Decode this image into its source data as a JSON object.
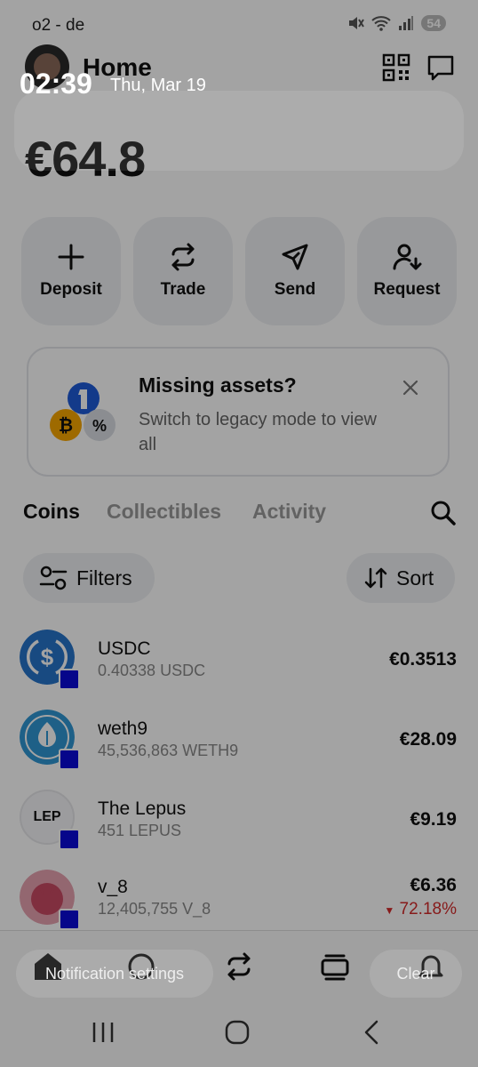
{
  "status_bar": {
    "carrier": "o2 - de",
    "battery": "54"
  },
  "lock_overlay": {
    "time": "02:39",
    "date": "Thu, Mar 19"
  },
  "header": {
    "title": "Home"
  },
  "balance": "€64.8",
  "actions": [
    {
      "label": "Deposit",
      "icon": "plus-icon"
    },
    {
      "label": "Trade",
      "icon": "trade-arrows-icon"
    },
    {
      "label": "Send",
      "icon": "send-icon"
    },
    {
      "label": "Request",
      "icon": "request-user-icon"
    }
  ],
  "banner": {
    "title": "Missing assets?",
    "text": "Switch to legacy mode to view all"
  },
  "tabs": [
    {
      "label": "Coins",
      "active": true
    },
    {
      "label": "Collectibles",
      "active": false
    },
    {
      "label": "Activity",
      "active": false
    }
  ],
  "filters": {
    "filters_label": "Filters",
    "sort_label": "Sort"
  },
  "coins": [
    {
      "name": "USDC",
      "amount": "0.40338 USDC",
      "value": "€0.3513",
      "change": ""
    },
    {
      "name": "weth9",
      "amount": "45,536,863 WETH9",
      "value": "€28.09",
      "change": ""
    },
    {
      "name": "The Lepus",
      "amount": "451 LEPUS",
      "value": "€9.19",
      "change": "",
      "logo_text": "LEP"
    },
    {
      "name": "v_8",
      "amount": "12,405,755 V_8",
      "value": "€6.36",
      "change": "72.18%"
    }
  ],
  "notification": {
    "settings_label": "Notification settings",
    "clear_label": "Clear"
  },
  "colors": {
    "accent_blue": "#2775ca",
    "badge_blue": "#0a0ad8",
    "negative": "#d42b2b"
  }
}
